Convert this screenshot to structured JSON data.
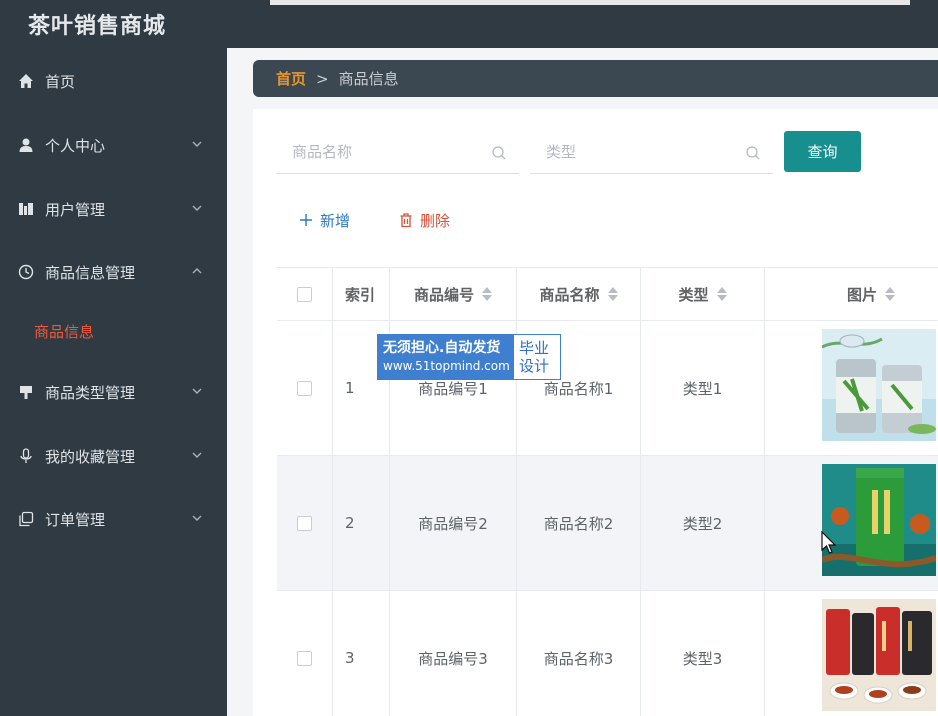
{
  "app": {
    "title": "茶叶销售商城"
  },
  "sidebar": {
    "items": [
      {
        "label": "首页",
        "icon": "home-icon"
      },
      {
        "label": "个人中心",
        "icon": "user-icon"
      },
      {
        "label": "用户管理",
        "icon": "users-icon"
      },
      {
        "label": "商品信息管理",
        "icon": "clock-icon"
      },
      {
        "label": "商品类型管理",
        "icon": "tag-icon"
      },
      {
        "label": "我的收藏管理",
        "icon": "microphone-icon"
      },
      {
        "label": "订单管理",
        "icon": "copy-icon"
      }
    ],
    "active_sub": "商品信息"
  },
  "breadcrumb": {
    "home": "首页",
    "separator": ">",
    "current": "商品信息"
  },
  "search": {
    "name_placeholder": "商品名称",
    "type_placeholder": "类型",
    "query_label": "查询"
  },
  "actions": {
    "add_label": "新增",
    "delete_label": "删除"
  },
  "table": {
    "headers": {
      "index": "索引",
      "code": "商品编号",
      "name": "商品名称",
      "type": "类型",
      "image": "图片"
    },
    "rows": [
      {
        "index": "1",
        "code": "商品编号1",
        "name": "商品名称1",
        "type": "类型1"
      },
      {
        "index": "2",
        "code": "商品编号2",
        "name": "商品名称2",
        "type": "类型2"
      },
      {
        "index": "3",
        "code": "商品编号3",
        "name": "商品名称3",
        "type": "类型3"
      }
    ]
  },
  "watermark": {
    "line1": "无须担心.自动发货",
    "line2": "www.51topmind.com",
    "right1": "毕业",
    "right2": "设计"
  },
  "colors": {
    "sidebar": "#2f3a43",
    "accent": "#178f8f",
    "active": "#ef5a3c",
    "home": "#e4962d",
    "add": "#2b77c3",
    "delete": "#d6503a"
  }
}
